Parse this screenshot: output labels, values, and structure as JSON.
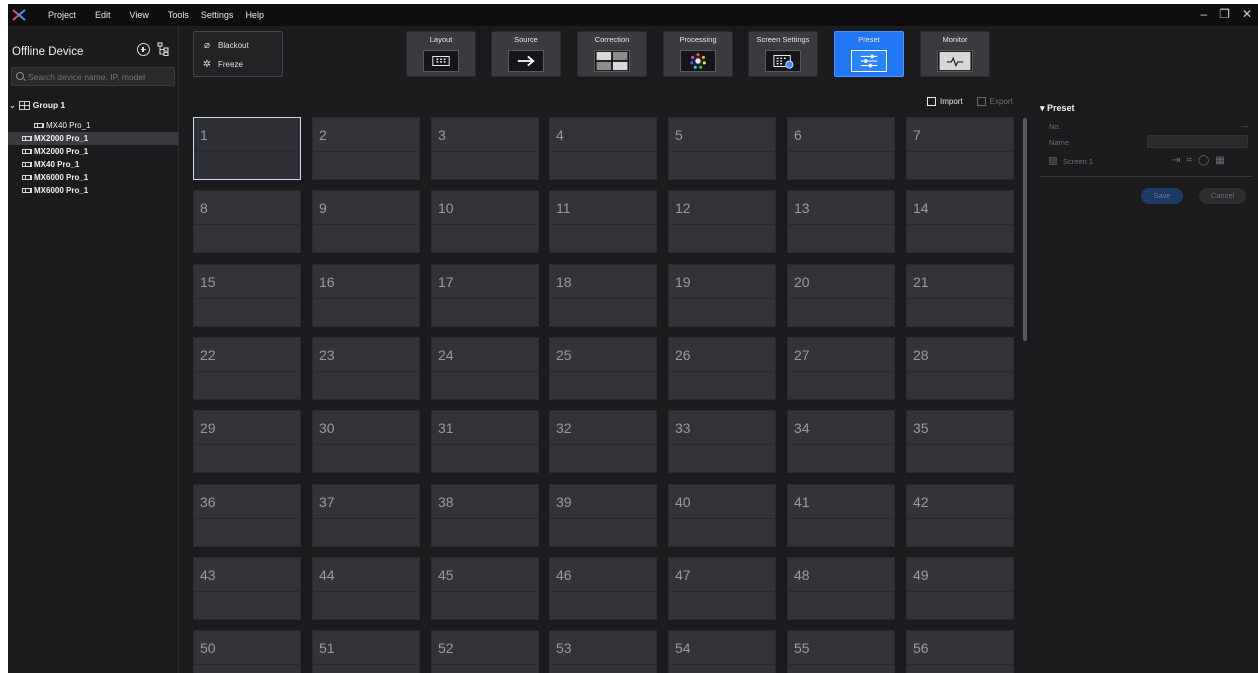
{
  "menubar": {
    "items": [
      "Project",
      "Edit",
      "View",
      "Tools",
      "Settings",
      "Help"
    ],
    "window_controls": [
      "–",
      "❐",
      "✕"
    ]
  },
  "left_panel": {
    "title": "Offline Device",
    "search_placeholder": "Search device name, IP, model",
    "group_name": "Group 1",
    "devices": [
      {
        "label": "MX40 Pro_1",
        "selected": false,
        "bold": false
      },
      {
        "label": "MX2000 Pro_1",
        "selected": true,
        "bold": true
      },
      {
        "label": "MX2000 Pro_1",
        "selected": false,
        "bold": true
      },
      {
        "label": "MX40 Pro_1",
        "selected": false,
        "bold": true
      },
      {
        "label": "MX6000 Pro_1",
        "selected": false,
        "bold": true
      },
      {
        "label": "MX6000 Pro_1",
        "selected": false,
        "bold": true
      }
    ]
  },
  "quick_actions": {
    "blackout": "Blackout",
    "freeze": "Freeze"
  },
  "toolbar": {
    "tools": [
      {
        "label": "Layout",
        "icon": "layout-icon",
        "active": false
      },
      {
        "label": "Source",
        "icon": "source-arrow-icon",
        "active": false
      },
      {
        "label": "Correction",
        "icon": "correction-icon",
        "active": false
      },
      {
        "label": "Processing",
        "icon": "processing-color-wheel-icon",
        "active": false
      },
      {
        "label": "Screen Settings",
        "icon": "screen-settings-icon",
        "active": false
      },
      {
        "label": "Preset",
        "icon": "preset-sliders-icon",
        "active": true
      },
      {
        "label": "Monitor",
        "icon": "monitor-pulse-icon",
        "active": false
      }
    ]
  },
  "actions": {
    "import": "Import",
    "export": "Export"
  },
  "preset_grid": {
    "selected": "1",
    "items": [
      "1",
      "2",
      "3",
      "4",
      "5",
      "6",
      "7",
      "8",
      "9",
      "10",
      "11",
      "12",
      "13",
      "14",
      "15",
      "16",
      "17",
      "18",
      "19",
      "20",
      "21",
      "22",
      "23",
      "24",
      "25",
      "26",
      "27",
      "28",
      "29",
      "30",
      "31",
      "32",
      "33",
      "34",
      "35",
      "36",
      "37",
      "38",
      "39",
      "40",
      "41",
      "42",
      "43",
      "44",
      "45",
      "46",
      "47",
      "48",
      "49",
      "50",
      "51",
      "52",
      "53",
      "54",
      "55",
      "56"
    ]
  },
  "right_panel": {
    "title": "Preset",
    "no_label": "No.",
    "no_value": "---",
    "name_label": "Name",
    "screen_label": "Screen 1",
    "save": "Save",
    "cancel": "Cancel"
  },
  "colors": {
    "accent": "#2176f3",
    "background": "#1b1b1d",
    "tile": "#333438",
    "selection_outline": "#cfd6ff"
  }
}
